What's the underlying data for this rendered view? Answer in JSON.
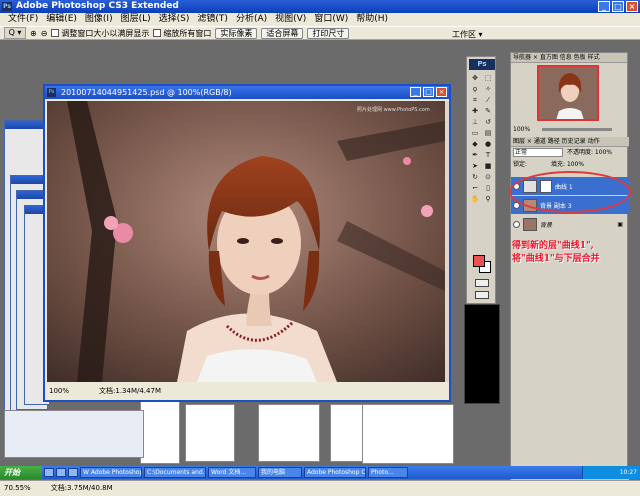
{
  "window": {
    "title": "Adobe Photoshop CS3 Extended",
    "min": "_",
    "max": "□",
    "close": "×"
  },
  "menu": [
    "文件(F)",
    "编辑(E)",
    "图像(I)",
    "图层(L)",
    "选择(S)",
    "滤镜(T)",
    "分析(A)",
    "视图(V)",
    "窗口(W)",
    "帮助(H)"
  ],
  "options": {
    "zoom_tool": "Q ▾",
    "check1": "调整窗口大小以满屏显示",
    "check2": "缩放所有窗口",
    "btn_actual": "实际像素",
    "btn_fit": "适合屏幕",
    "btn_print": "打印尺寸",
    "workspace": "工作区 ▾"
  },
  "document": {
    "title": "20100714044951425.psd @ 100%(RGB/8)",
    "watermark": "照片处理网 www.PhotoPS.com",
    "zoom": "100%",
    "doc_size": "文档:1.34M/4.47M"
  },
  "tools_panel": {
    "ps_logo": "Ps"
  },
  "navigator": {
    "tabs": "导航器 × 直方图 信息 色板 样式",
    "zoom": "100%"
  },
  "layers": {
    "tabs": "图层 × 通道 路径 历史记录 动作",
    "blend": "正常",
    "opacity_label": "不透明度: 100%",
    "lock_label": "锁定:",
    "fill_label": "填充: 100%",
    "rows": [
      {
        "name": "曲线 1"
      },
      {
        "name": "背景 副本 3"
      },
      {
        "name": "背景"
      }
    ]
  },
  "annotation": [
    "得到新的层\"曲线1\",",
    "将\"曲线1\"与下层合并"
  ],
  "taskbar": {
    "start": "开始",
    "items": [
      "W Adobe Photoshop...",
      "C:\\Documents and...",
      "Word 文档...",
      "我的电脑",
      "Adobe Photoshop CS...",
      "Photo..."
    ],
    "tray": "10:27"
  },
  "status": {
    "zoom": "70.55%",
    "doc": "文档:3.75M/40.8M"
  }
}
